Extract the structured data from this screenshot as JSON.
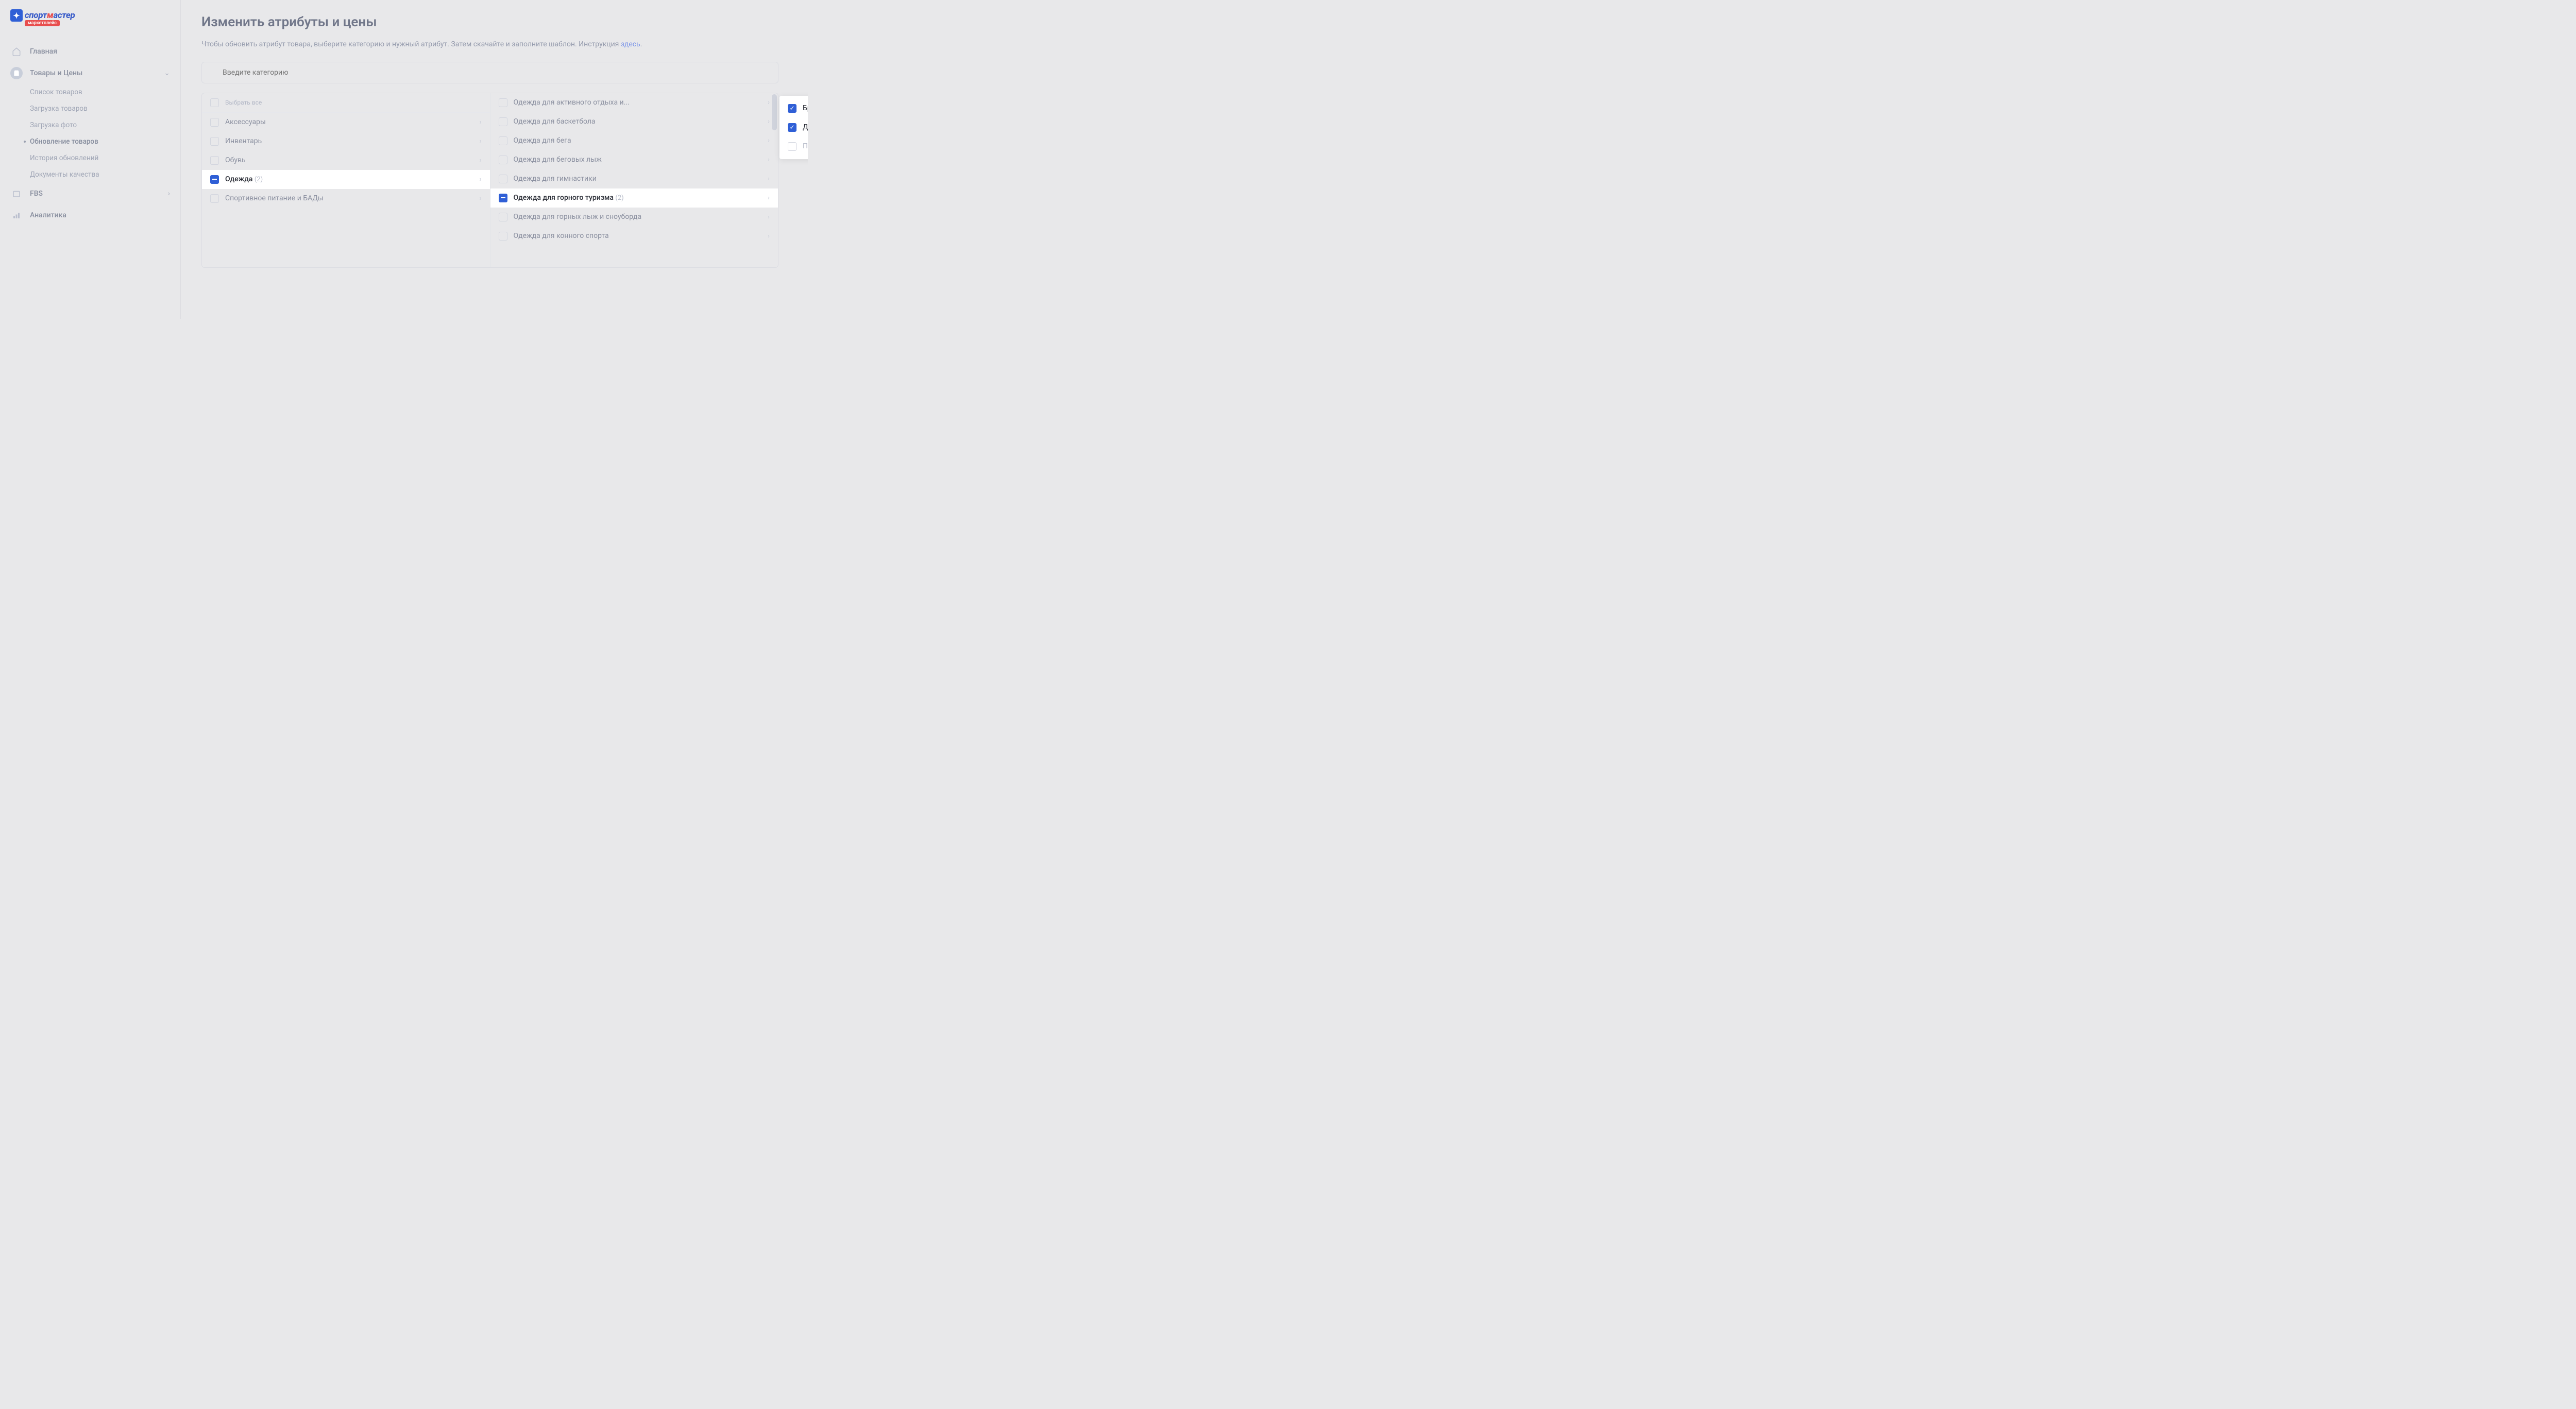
{
  "logo": {
    "text1": "спорт",
    "text2": "м",
    "text3": "астер",
    "sub": "маркетплейс"
  },
  "nav": {
    "home": "Главная",
    "products": "Товары и Цены",
    "sub": {
      "list": "Список товаров",
      "upload": "Загрузка товаров",
      "photo": "Загрузка фото",
      "update": "Обновление товаров",
      "history": "История обновлений",
      "docs": "Документы качества"
    },
    "fbs": "FBS",
    "analytics": "Аналитика"
  },
  "page": {
    "title": "Изменить атрибуты и цены",
    "desc1": "Чтобы обновить атрибут товара, выберите категорию и нужный атрибут. Затем скачайте и заполните шаблон. Инструкция ",
    "desc_link": "здесь",
    "desc2": ".",
    "search_placeholder": "Введите категорию",
    "select_all": "Выбрать все"
  },
  "col1": [
    {
      "label": "Аксессуары",
      "sel": false
    },
    {
      "label": "Инвентарь",
      "sel": false
    },
    {
      "label": "Обувь",
      "sel": false
    },
    {
      "label": "Одежда",
      "sel": true,
      "count": "(2)"
    },
    {
      "label": "Спортивное питание и БАДы",
      "sel": false
    }
  ],
  "col2": [
    {
      "label": "Одежда для активного отдыха и...",
      "sel": false
    },
    {
      "label": "Одежда для баскетбола",
      "sel": false
    },
    {
      "label": "Одежда для бега",
      "sel": false
    },
    {
      "label": "Одежда для беговых лыж",
      "sel": false
    },
    {
      "label": "Одежда для гимнастики",
      "sel": false
    },
    {
      "label": "Одежда для горного туризма",
      "sel": true,
      "count": "(2)"
    },
    {
      "label": "Одежда для горных лыж и сноуборда",
      "sel": false
    },
    {
      "label": "Одежда для конного спорта",
      "sel": false
    }
  ],
  "col3": [
    {
      "label": "Брюки для горного туризма",
      "checked": true
    },
    {
      "label": "Джемперы для горного туризма",
      "checked": true
    },
    {
      "label": "Полукомбинезоны для горного туризма",
      "checked": false
    }
  ]
}
